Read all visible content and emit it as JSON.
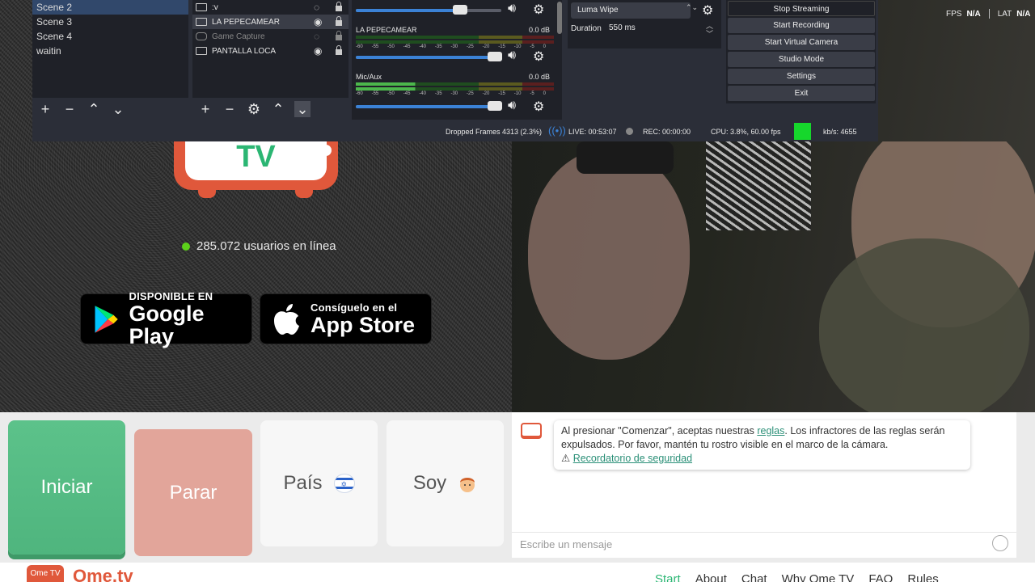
{
  "obs": {
    "scenes": [
      "Scene 2",
      "Scene 3",
      "Scene 4",
      "waitin"
    ],
    "sources": [
      {
        "label": ":v"
      },
      {
        "label": "LA PEPECAMEAR"
      },
      {
        "label": "Game Capture"
      },
      {
        "label": "PANTALLA LOCA"
      }
    ],
    "mixer": {
      "tracks": [
        {
          "name": "LA PEPECAMEAR",
          "db": "0.0 dB"
        },
        {
          "name": "Mic/Aux",
          "db": "0.0 dB"
        }
      ],
      "ticks": [
        "-60",
        "-55",
        "-50",
        "-45",
        "-40",
        "-35",
        "-30",
        "-25",
        "-20",
        "-15",
        "-10",
        "-5",
        "0"
      ]
    },
    "transition": {
      "selected": "Luma Wipe",
      "duration_label": "Duration",
      "duration_value": "550 ms"
    },
    "controls": [
      "Stop Streaming",
      "Start Recording",
      "Start Virtual Camera",
      "Studio Mode",
      "Settings",
      "Exit"
    ],
    "status": {
      "dropped": "Dropped Frames 4313 (2.3%)",
      "live": "LIVE: 00:53:07",
      "rec": "REC: 00:00:00",
      "cpu": "CPU: 3.8%, 60.00 fps",
      "kbs": "kb/s: 4655"
    }
  },
  "overlay": {
    "fps_label": "FPS",
    "fps_value": "N/A",
    "lat_label": "LAT",
    "lat_value": "N/A"
  },
  "ome": {
    "logo_text": "TV",
    "online": "285.072 usuarios en línea",
    "gplay_small": "DISPONIBLE EN",
    "gplay_big": "Google Play",
    "appstore_small": "Consíguelo en el",
    "appstore_big": "App Store",
    "buttons": {
      "start": "Iniciar",
      "stop": "Parar",
      "country": "País",
      "gender": "Soy"
    },
    "chat": {
      "msg_pre": "Al presionar \"Comenzar\", aceptas nuestras ",
      "msg_link": "reglas",
      "msg_post": ". Los infractores de las reglas serán expulsados. Por favor, mantén tu rostro visible en el marco de la cámara.",
      "safety": "Recordatorio de seguridad",
      "placeholder": "Escribe un mensaje",
      "badge": "Ome TV"
    },
    "footer": {
      "brand": "Ome.tv",
      "nav": [
        "Start",
        "About",
        "Chat",
        "Why Ome TV",
        "FAQ",
        "Rules"
      ]
    },
    "colors": {
      "brand_red": "#e0583b",
      "brand_green": "#2bb673",
      "online_dot": "#5cd11a"
    }
  }
}
